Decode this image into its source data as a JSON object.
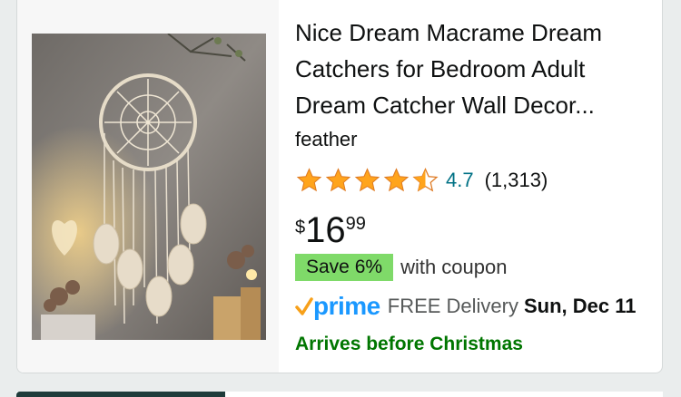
{
  "product": {
    "title": "Nice Dream Macrame Dream Catchers for Bedroom Adult Dream Catcher Wall Decor...",
    "brand": "feather",
    "rating": {
      "value": "4.7",
      "count": "(1,313)",
      "stars": 4.5
    },
    "price": {
      "symbol": "$",
      "whole": "16",
      "fraction": "99"
    },
    "coupon": {
      "badge": "Save 6%",
      "text": "with coupon"
    },
    "delivery": {
      "prime_label": "prime",
      "text": "FREE Delivery",
      "date": "Sun, Dec 11"
    },
    "arrives": "Arrives before Christmas"
  },
  "colors": {
    "link": "#007185",
    "star": "#ffa41c",
    "coupon_badge": "#7fda69",
    "prime_blue": "#1a98ff",
    "prime_check": "#f7a01a",
    "arrives_green": "#007600"
  },
  "icons": {
    "star": "star-icon",
    "prime": "prime-check-icon"
  }
}
